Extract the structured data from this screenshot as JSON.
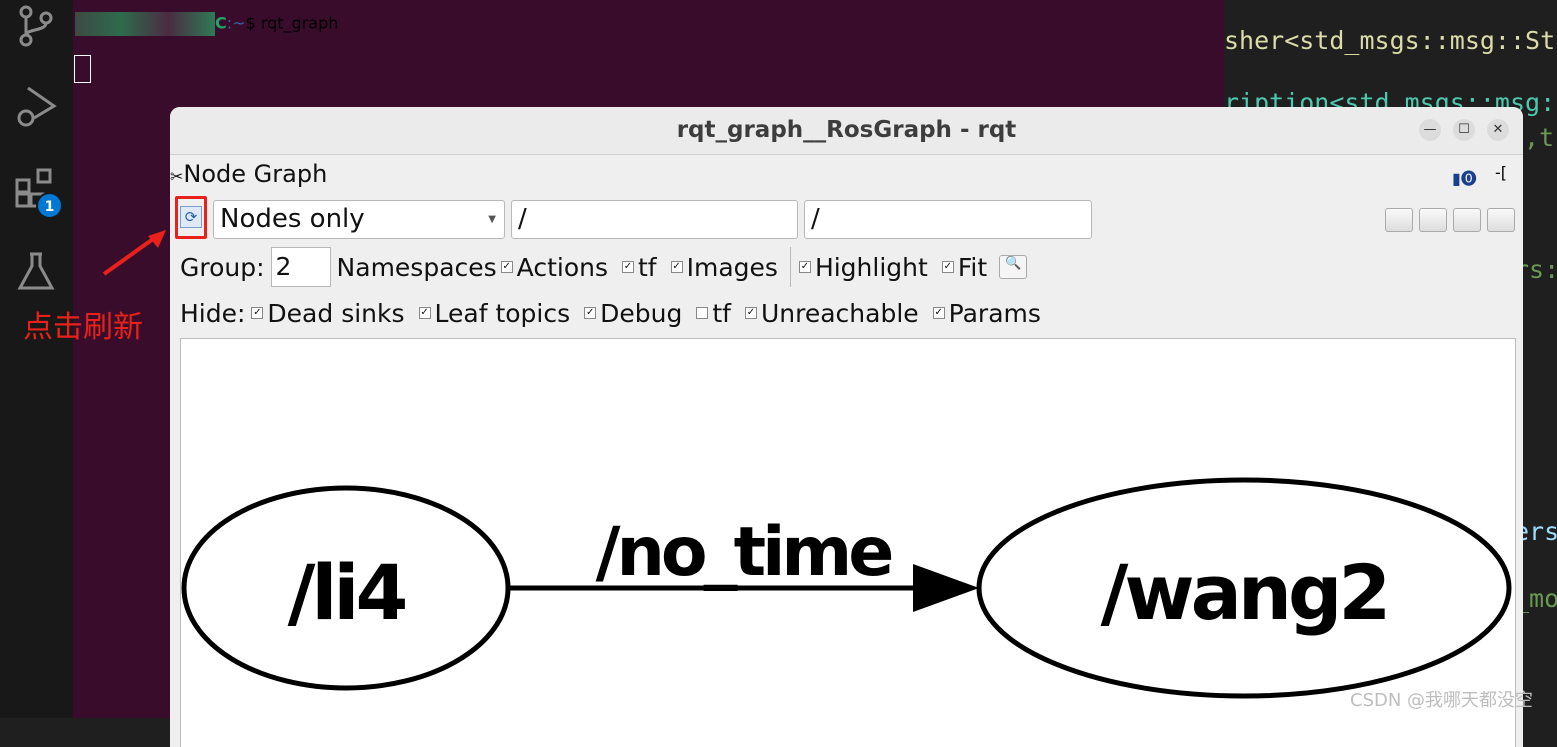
{
  "activity_bar": {
    "extensions_badge": "1"
  },
  "terminal": {
    "prompt_suffix": "C",
    "prompt_path": ":~",
    "prompt_dollar": "$ ",
    "command": "rqt_graph"
  },
  "editor": {
    "lines": [
      "sher<std_msgs::msg::Str",
      "ription<std_msgs::msg::",
      ",t",
      "rs:",
      "ers",
      "_mo"
    ]
  },
  "window": {
    "title": "rqt_graph__RosGraph - rqt",
    "plugin_title": "Node Graph",
    "toolbar": {
      "mode": "Nodes only",
      "filter1": "/",
      "filter2": "/"
    },
    "group": {
      "label": "Group:",
      "value": "2"
    },
    "options": [
      {
        "label": "Namespaces",
        "checked": null
      },
      {
        "label": "Actions",
        "checked": true
      },
      {
        "label": "tf",
        "checked": true
      },
      {
        "label": "Images",
        "checked": true
      },
      {
        "label": "Highlight",
        "checked": true
      },
      {
        "label": "Fit",
        "checked": true
      }
    ],
    "hide": {
      "label": "Hide:",
      "items": [
        {
          "label": "Dead sinks",
          "checked": true
        },
        {
          "label": "Leaf topics",
          "checked": true
        },
        {
          "label": "Debug",
          "checked": true
        },
        {
          "label": "tf",
          "checked": false
        },
        {
          "label": "Unreachable",
          "checked": true
        },
        {
          "label": "Params",
          "checked": true
        }
      ]
    },
    "graph": {
      "nodes": [
        "/li4",
        "/wang2"
      ],
      "edge_label": "/no_time"
    }
  },
  "annotation": "点击刷新",
  "watermark": "CSDN @我哪天都没空"
}
